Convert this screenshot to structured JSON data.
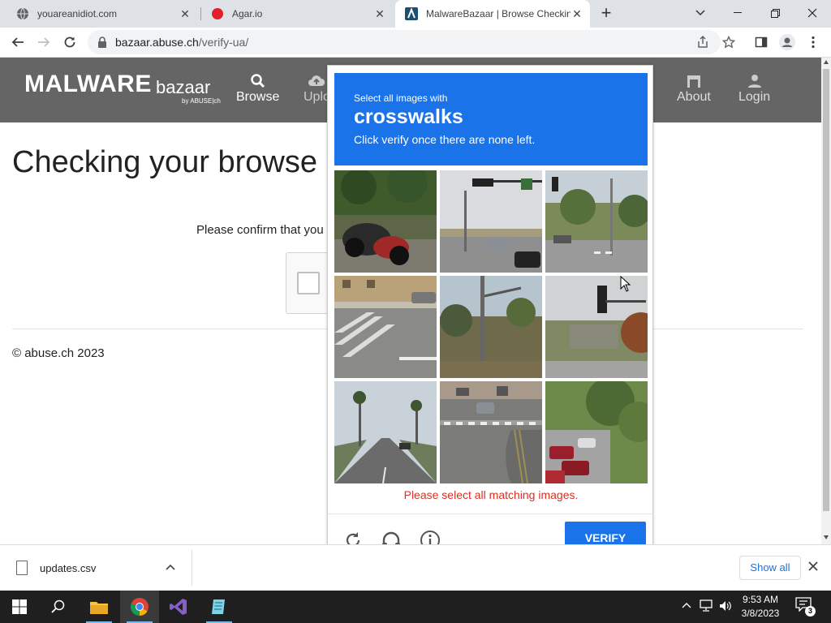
{
  "tabs": [
    {
      "title": "youareanidiot.com",
      "icon": "globe-icon"
    },
    {
      "title": "Agar.io",
      "icon": "agar-icon"
    },
    {
      "title": "MalwareBazaar | Browse Checkin",
      "icon": "abuse-logo-icon"
    }
  ],
  "toolbar": {
    "url_host": "bazaar.abuse.ch",
    "url_path": "/verify-ua/"
  },
  "site": {
    "logo_main": "MALWARE",
    "logo_sub": "bazaar",
    "logo_by": "by ABUSE|ch",
    "nav": {
      "browse": "Browse",
      "upload": "Uplo",
      "about": "About",
      "login": "Login"
    },
    "title": "Checking your browse",
    "confirm": "Please confirm that you",
    "footer": "© abuse.ch 2023"
  },
  "challenge": {
    "line1": "Select all images with",
    "keyword": "crosswalks",
    "line3": "Click verify once there are none left.",
    "error": "Please select all matching images.",
    "verify": "VERIFY",
    "tiles": [
      "motorcycles-tile",
      "intersection-suv-tile",
      "traffic-light-street-tile",
      "crosswalk-corner-tile",
      "hillside-pole-tile",
      "traffic-light-building-tile",
      "palm-street-tile",
      "crosswalk-overhead-tile",
      "parked-cars-tile"
    ],
    "colors": {
      "header": "#1a73e8",
      "error": "#d93025"
    }
  },
  "downloads": {
    "file": "updates.csv",
    "show_all": "Show all"
  },
  "taskbar": {
    "time": "9:53 AM",
    "date": "3/8/2023",
    "notifications": "3"
  }
}
